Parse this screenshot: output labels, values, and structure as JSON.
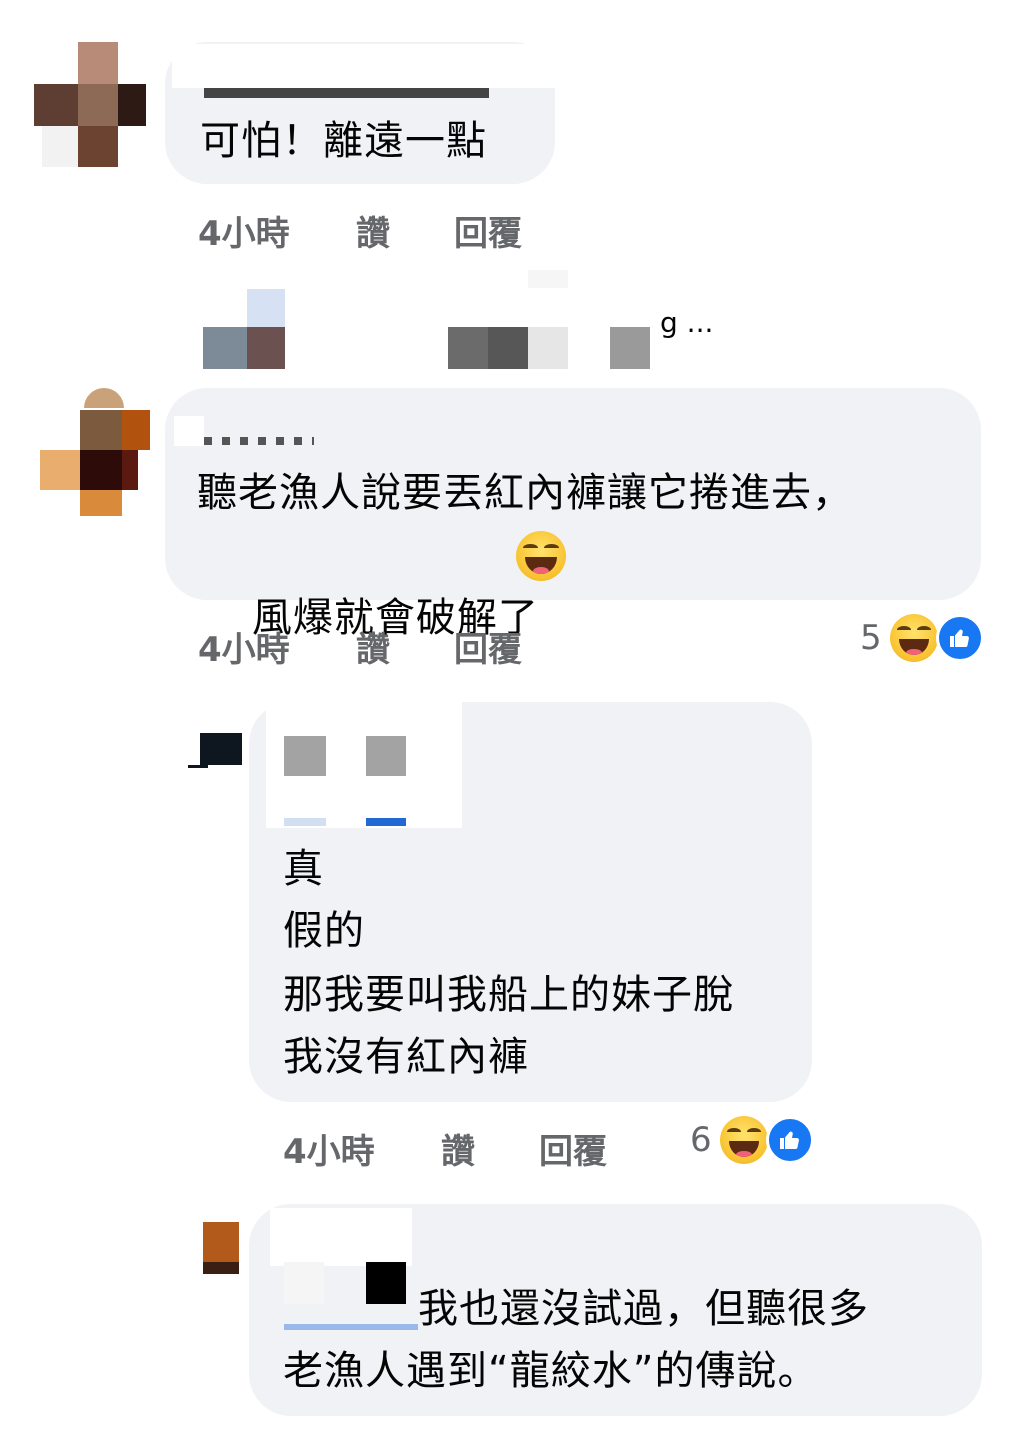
{
  "comments": [
    {
      "id": "c1",
      "text": "可怕！離遠一點",
      "actions": {
        "time": "4小時",
        "like": "讚",
        "reply": "回覆"
      }
    },
    {
      "id": "collapsed",
      "suffix": "g ..."
    },
    {
      "id": "c2",
      "text_line1": "聽老漁人說要丟紅內褲讓它捲進去，",
      "text_line2": "風爆就會破解了",
      "actions": {
        "time": "4小時",
        "like": "讚",
        "reply": "回覆"
      },
      "reactions": {
        "count": "5",
        "icons": [
          "haha-icon",
          "like-icon"
        ]
      }
    },
    {
      "id": "c3",
      "lines": [
        "真",
        "假的",
        "那我要叫我船上的妹子脫",
        "我沒有紅內褲"
      ],
      "actions": {
        "time": "4小時",
        "like": "讚",
        "reply": "回覆"
      },
      "reactions": {
        "count": "6",
        "icons": [
          "haha-icon",
          "like-icon"
        ]
      }
    },
    {
      "id": "c4",
      "text_line1": "我也還沒試過，但聽很多",
      "text_line2": "老漁人遇到“龍絞水”的傳說。"
    }
  ],
  "colors": {
    "bubble": "#f0f2f5",
    "meta": "#65676b",
    "link": "#216fdb",
    "like_blue": "#1877f2"
  }
}
